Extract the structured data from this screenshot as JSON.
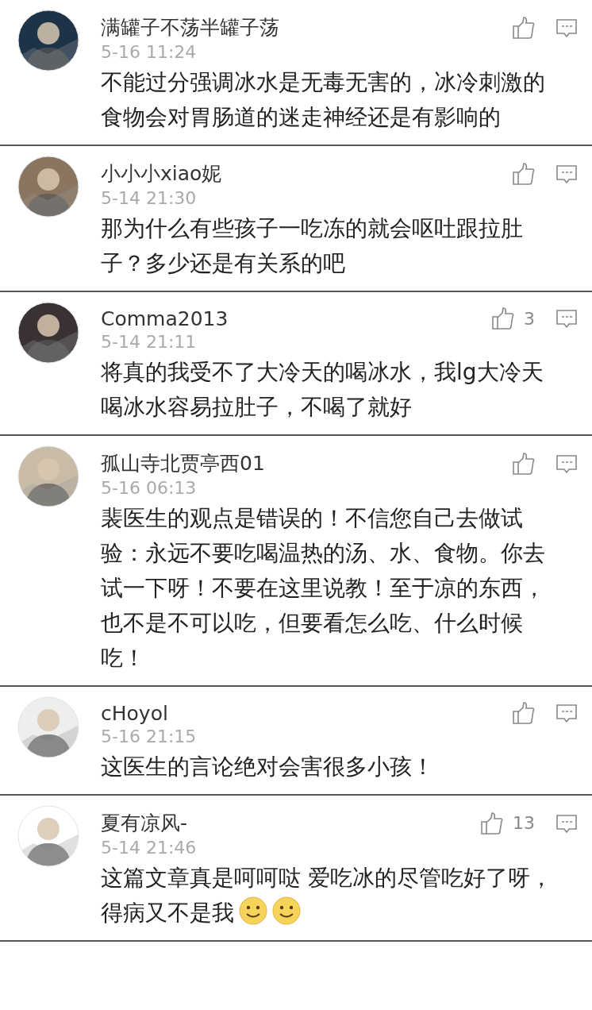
{
  "comments": [
    {
      "name": "满罐子不荡半罐子荡",
      "time": "5-16 11:24",
      "text": "不能过分强调冰水是无毒无害的，冰冷刺激的食物会对胃肠道的迷走神经还是有影响的"
    },
    {
      "name": "小小小xiao妮",
      "time": "5-14 21:30",
      "text": "那为什么有些孩子一吃冻的就会呕吐跟拉肚子？多少还是有关系的吧"
    },
    {
      "name": "Comma2013",
      "time": "5-14 21:11",
      "likes": "3",
      "text": "将真的我受不了大冷天的喝冰水，我lg大冷天喝冰水容易拉肚子，不喝了就好"
    },
    {
      "name": "孤山寺北贾亭西01",
      "time": "5-16 06:13",
      "text": "裴医生的观点是错误的！不信您自己去做试验：永远不要吃喝温热的汤、水、食物。你去试一下呀！不要在这里说教！至于凉的东西，也不是不可以吃，但要看怎么吃、什么时候吃！"
    },
    {
      "name": "cHoyol",
      "time": "5-16 21:15",
      "text": "这医生的言论绝对会害很多小孩！"
    },
    {
      "name": "夏有凉风-",
      "time": "5-14 21:46",
      "likes": "13",
      "text": "这篇文章真是呵呵哒 爱吃冰的尽管吃好了呀，得病又不是我",
      "emoji": [
        {
          "kind": "smile"
        },
        {
          "kind": "smile"
        }
      ]
    }
  ]
}
